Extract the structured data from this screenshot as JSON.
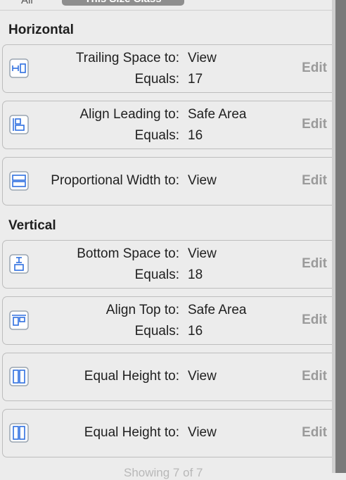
{
  "segments": {
    "all": "All",
    "this_size_class": "This Size Class"
  },
  "sections": [
    {
      "title": "Horizontal",
      "constraints": [
        {
          "label": "Trailing Space to:",
          "value": "View",
          "equals_label": "Equals:",
          "equals_value": "17",
          "edit": "Edit",
          "icon": "trailing-space-icon"
        },
        {
          "label": "Align Leading to:",
          "value": "Safe Area",
          "equals_label": "Equals:",
          "equals_value": "16",
          "edit": "Edit",
          "icon": "align-leading-icon"
        },
        {
          "label": "Proportional Width to:",
          "value": "View",
          "edit": "Edit",
          "icon": "proportional-width-icon"
        }
      ]
    },
    {
      "title": "Vertical",
      "constraints": [
        {
          "label": "Bottom Space to:",
          "value": "View",
          "equals_label": "Equals:",
          "equals_value": "18",
          "edit": "Edit",
          "icon": "bottom-space-icon"
        },
        {
          "label": "Align Top to:",
          "value": "Safe Area",
          "equals_label": "Equals:",
          "equals_value": "16",
          "edit": "Edit",
          "icon": "align-top-icon"
        },
        {
          "label": "Equal Height to:",
          "value": "View",
          "edit": "Edit",
          "icon": "equal-height-icon"
        },
        {
          "label": "Equal Height to:",
          "value": "View",
          "edit": "Edit",
          "icon": "equal-height-icon"
        }
      ]
    }
  ],
  "footer": "Showing 7 of 7"
}
